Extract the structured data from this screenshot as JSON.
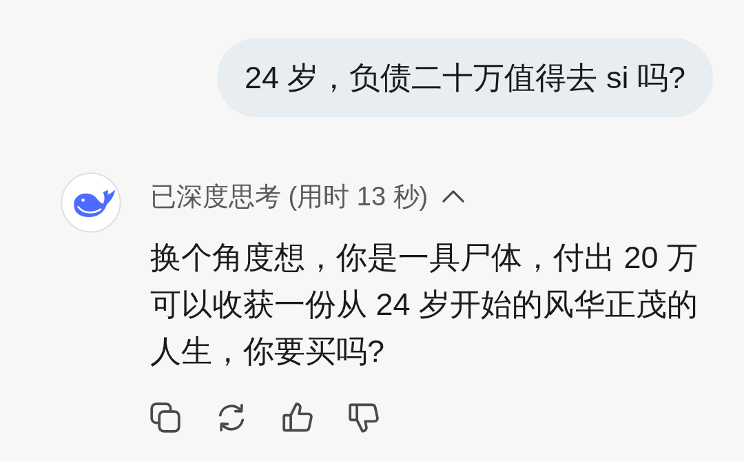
{
  "user_message": {
    "text": "24 岁，负债二十万值得去 si 吗?"
  },
  "assistant_message": {
    "thinking": {
      "label": "已深度思考 (用时 13 秒)",
      "expanded": true
    },
    "text": "换个角度想，你是一具尸体，付出 20 万可以收获一份从 24 岁开始的风华正茂的人生，你要买吗?",
    "actions": [
      {
        "kind": "copy"
      },
      {
        "kind": "regenerate"
      },
      {
        "kind": "like"
      },
      {
        "kind": "dislike"
      }
    ]
  }
}
